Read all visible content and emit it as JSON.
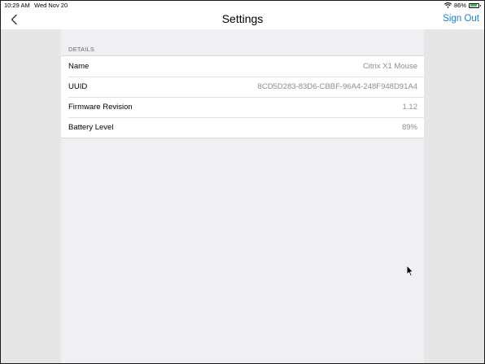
{
  "status_bar": {
    "time": "10:29 AM",
    "date": "Wed Nov 20",
    "battery_percent_label": "86%",
    "battery_level": 0.86,
    "wifi_icon": "wifi-icon",
    "battery_icon": "battery-icon"
  },
  "nav": {
    "back_icon": "chevron-left-icon",
    "title": "Settings",
    "sign_out_label": "Sign Out",
    "accent_color": "#1a7fdc"
  },
  "details": {
    "section_title": "DETAILS",
    "rows": [
      {
        "label": "Name",
        "value": "Citrix X1 Mouse"
      },
      {
        "label": "UUID",
        "value": "8CD5D283-83D6-CBBF-96A4-248F948D91A4"
      },
      {
        "label": "Firmware Revision",
        "value": "1.12"
      },
      {
        "label": "Battery Level",
        "value": "89%"
      }
    ]
  },
  "colors": {
    "battery_fill": "#34c759",
    "secondary_text": "#8e8e93",
    "grouped_background": "#efeff4"
  }
}
